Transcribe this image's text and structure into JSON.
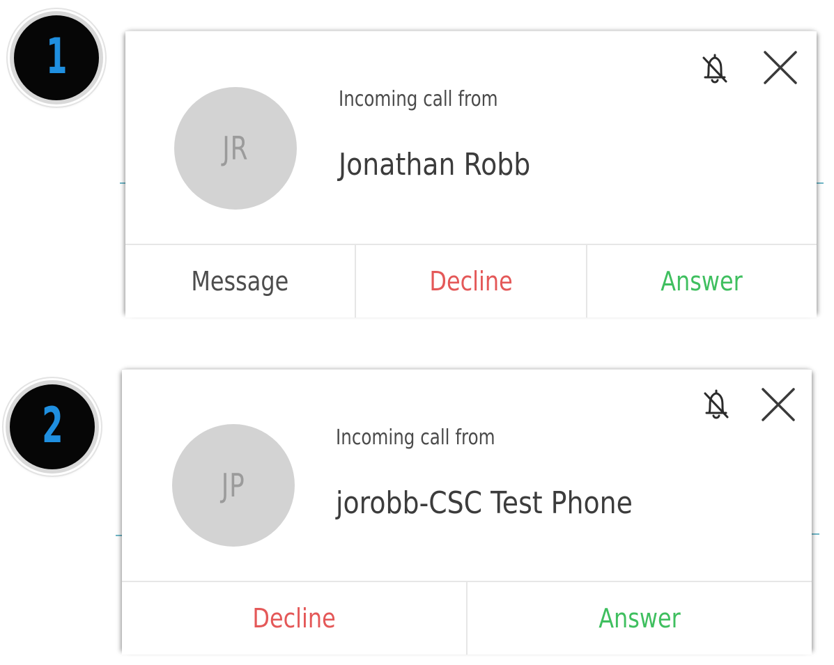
{
  "steps": [
    {
      "number": "1"
    },
    {
      "number": "2"
    }
  ],
  "notifications": [
    {
      "avatar_initials": "JR",
      "label": "Incoming call from",
      "caller": "Jonathan Robb",
      "icons": [
        "bell-off-icon",
        "close-icon"
      ],
      "actions": [
        {
          "label": "Message",
          "kind": "message"
        },
        {
          "label": "Decline",
          "kind": "decline"
        },
        {
          "label": "Answer",
          "kind": "answer"
        }
      ]
    },
    {
      "avatar_initials": "JP",
      "label": "Incoming call from",
      "caller": "jorobb-CSC Test Phone",
      "icons": [
        "bell-off-icon",
        "close-icon"
      ],
      "actions": [
        {
          "label": "Decline",
          "kind": "decline"
        },
        {
          "label": "Answer",
          "kind": "answer"
        }
      ]
    }
  ],
  "colors": {
    "badge_background": "#060606",
    "badge_number": "#1f8fe0",
    "avatar_background": "#d3d3d3",
    "decline": "#e45858",
    "answer": "#3fbf5f",
    "message": "#4d4d4d"
  }
}
